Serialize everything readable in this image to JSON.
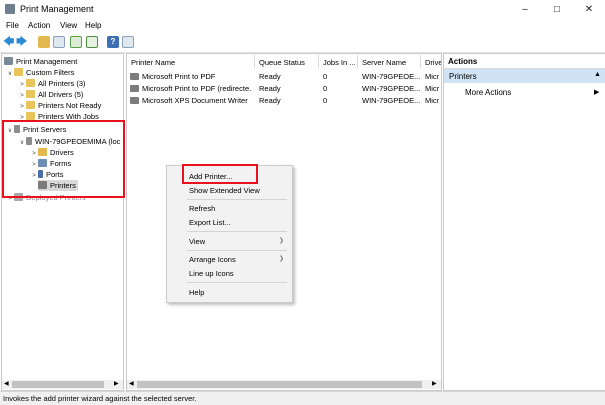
{
  "window": {
    "title": "Print Management"
  },
  "menu": [
    "File",
    "Action",
    "View",
    "Help"
  ],
  "tree": {
    "root": "Print Management",
    "custom_filters": "Custom Filters",
    "all_printers": "All Printers (3)",
    "all_drivers": "All Drivers (5)",
    "printers_not_ready": "Printers Not Ready",
    "printers_with_jobs": "Printers With Jobs",
    "print_servers": "Print Servers",
    "server": "WIN-79GPEOEMIMA (loc",
    "drivers": "Drivers",
    "forms": "Forms",
    "ports": "Ports",
    "printers": "Printers",
    "deployed_printers": "Deployed Printers"
  },
  "list": {
    "columns": [
      "Printer Name",
      "Queue Status",
      "Jobs In ...",
      "Server Name",
      "Drive"
    ],
    "rows": [
      [
        "Microsoft Print to PDF",
        "Ready",
        "0",
        "WIN-79GPEOE...",
        "Micr"
      ],
      [
        "Microsoft Print to PDF (redirecte...",
        "Ready",
        "0",
        "WIN-79GPEOE...",
        "Micr"
      ],
      [
        "Microsoft XPS Document Writer",
        "Ready",
        "0",
        "WIN-79GPEOE...",
        "Micr"
      ]
    ]
  },
  "context_menu": {
    "add_printer": "Add Printer...",
    "show_extended_view": "Show Extended View",
    "refresh": "Refresh",
    "export_list": "Export List...",
    "view": "View",
    "arrange_icons": "Arrange Icons",
    "line_up_icons": "Line up Icons",
    "help": "Help"
  },
  "actions": {
    "header": "Actions",
    "section": "Printers",
    "more_actions": "More Actions"
  },
  "status": "Invokes the add printer wizard against the selected server.",
  "colors": {
    "highlight_box": "#e8121f",
    "selection": "#cfe3f4",
    "folder": "#e8c45a"
  }
}
